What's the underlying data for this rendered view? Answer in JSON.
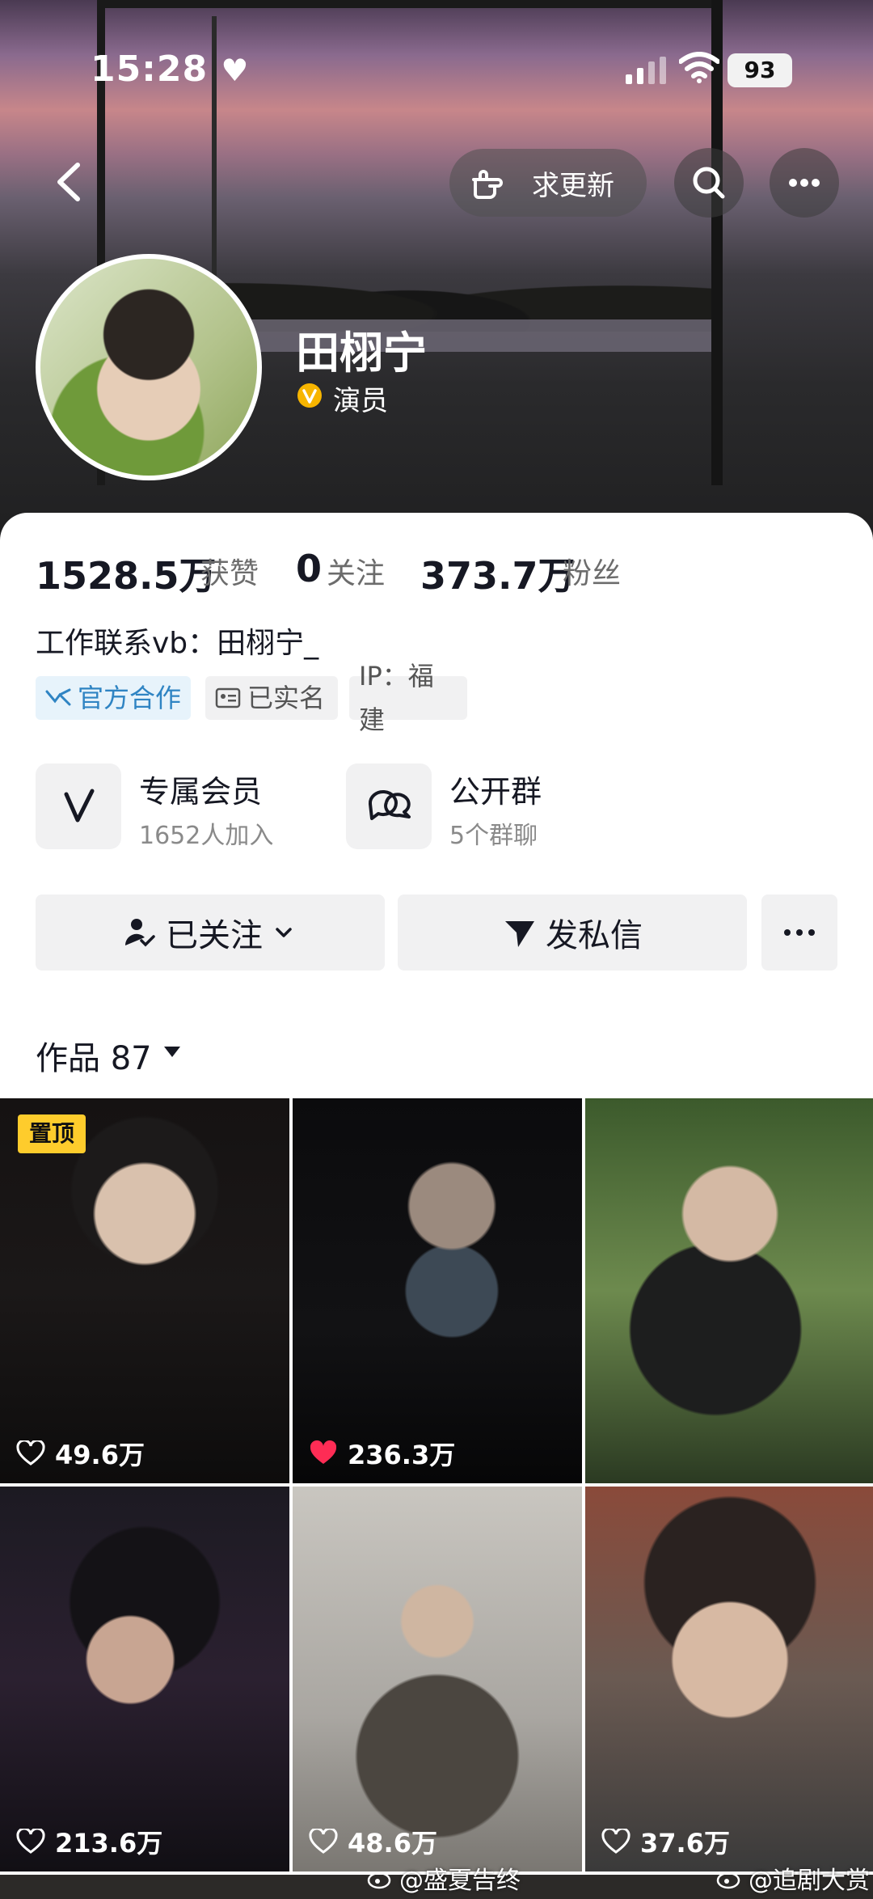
{
  "status_bar": {
    "time": "15:28",
    "battery": "93"
  },
  "header": {
    "request_update_label": "求更新"
  },
  "profile": {
    "name": "田栩宁",
    "role": "演员"
  },
  "stats": {
    "likes_count": "1528.5万",
    "likes_label": "获赞",
    "following_count": "0",
    "following_label": "关注",
    "fans_count": "373.7万",
    "fans_label": "粉丝"
  },
  "bio": "工作联系vb：田栩宁_",
  "tags": {
    "official": "官方合作",
    "realname": "已实名",
    "ip": "IP：福建"
  },
  "features": {
    "vip_title": "专属会员",
    "vip_sub": "1652人加入",
    "group_title": "公开群",
    "group_sub": "5个群聊"
  },
  "actions": {
    "followed": "已关注",
    "message": "发私信"
  },
  "works": {
    "label": "作品",
    "count": "87"
  },
  "grid": {
    "pinned_label": "置顶",
    "items": [
      {
        "likes": "49.6万",
        "liked": false
      },
      {
        "likes": "236.3万",
        "liked": true
      },
      {
        "likes": "",
        "liked": false
      },
      {
        "likes": "213.6万",
        "liked": false
      },
      {
        "likes": "48.6万",
        "liked": false
      },
      {
        "likes": "37.6万",
        "liked": false
      }
    ]
  },
  "watermarks": [
    "@盛夏告终",
    "@追剧大赏"
  ],
  "colors": {
    "accent_blue": "#2f84c3",
    "heart_red": "#fe2c55",
    "pinned_yellow": "#fecc2c"
  }
}
